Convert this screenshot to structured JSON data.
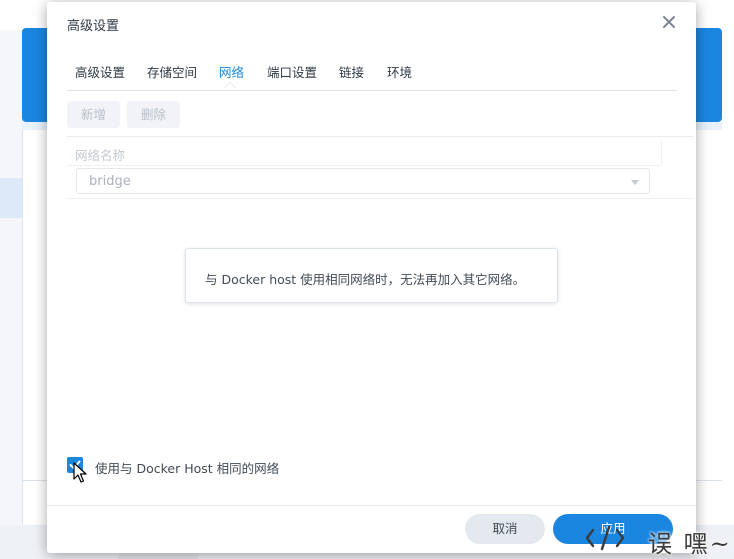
{
  "dialog": {
    "title": "高级设置",
    "close_icon": "close-icon"
  },
  "tabs": [
    {
      "label": "高级设置",
      "active": false
    },
    {
      "label": "存储空间",
      "active": false
    },
    {
      "label": "网络",
      "active": true
    },
    {
      "label": "端口设置",
      "active": false
    },
    {
      "label": "链接",
      "active": false
    },
    {
      "label": "环境",
      "active": false
    }
  ],
  "toolbar": {
    "add_label": "新增",
    "delete_label": "删除"
  },
  "network_table": {
    "header": "网络名称",
    "selected_network": "bridge"
  },
  "message": "与 Docker host 使用相同网络时，无法再加入其它网络。",
  "host_network_option": {
    "label": "使用与 Docker Host 相同的网络",
    "checked": true
  },
  "footer": {
    "cancel_label": "取消",
    "apply_label": "应用"
  },
  "watermark": {
    "text": "误 嘿~"
  },
  "colors": {
    "accent": "#1b86e0",
    "disabled_text": "#b9c1ca"
  }
}
